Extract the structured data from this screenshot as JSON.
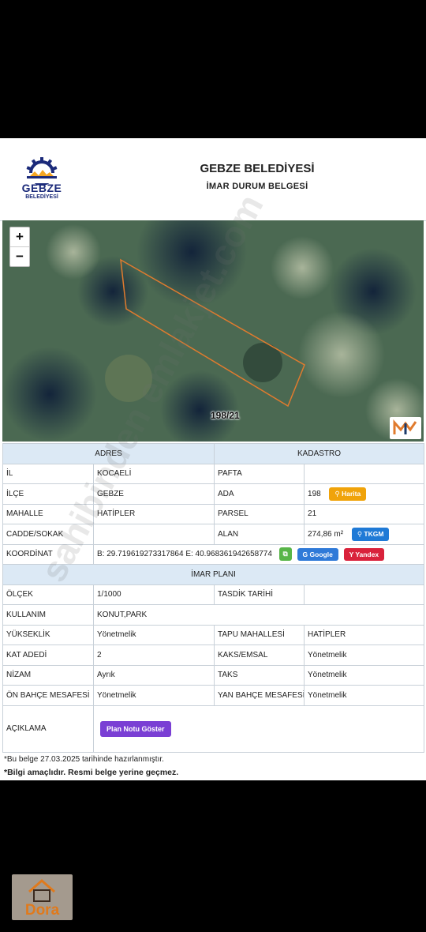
{
  "header": {
    "logo_text": "GEBZE",
    "logo_subtext": "BELEDİYESİ",
    "title": "GEBZE BELEDİYESİ",
    "subtitle": "İMAR DURUM BELGESİ"
  },
  "map": {
    "zoom_in": "+",
    "zoom_out": "−",
    "parcel_label": "198/21",
    "boundary_color": "#e07b2e"
  },
  "sections": {
    "adres": "ADRES",
    "kadastro": "KADASTRO",
    "imar": "İMAR PLANI"
  },
  "rows": {
    "il": {
      "label": "İL",
      "value": "KOCAELİ"
    },
    "pafta": {
      "label": "PAFTA",
      "value": ""
    },
    "ilce": {
      "label": "İLÇE",
      "value": "GEBZE"
    },
    "ada": {
      "label": "ADA",
      "value": "198"
    },
    "mahalle": {
      "label": "MAHALLE",
      "value": "HATİPLER"
    },
    "parsel": {
      "label": "PARSEL",
      "value": "21"
    },
    "cadde": {
      "label": "CADDE/SOKAK",
      "value": ""
    },
    "alan": {
      "label": "ALAN",
      "value": "274,86 m²"
    },
    "koordinat": {
      "label": "KOORDİNAT",
      "value": "B: 29.719619273317864 E: 40.968361942658774"
    },
    "olcek": {
      "label": "ÖLÇEK",
      "value": "1/1000"
    },
    "tasdik": {
      "label": "TASDİK TARİHİ",
      "value": ""
    },
    "kullanim": {
      "label": "KULLANIM",
      "value": "KONUT,PARK"
    },
    "yukseklik": {
      "label": "YÜKSEKLİK",
      "value": "Yönetmelik"
    },
    "tapu": {
      "label": "TAPU MAHALLESİ",
      "value": "HATİPLER"
    },
    "kat": {
      "label": "KAT ADEDİ",
      "value": "2"
    },
    "kaks": {
      "label": "KAKS/EMSAL",
      "value": "Yönetmelik"
    },
    "nizam": {
      "label": "NİZAM",
      "value": "Ayrık"
    },
    "taks": {
      "label": "TAKS",
      "value": "Yönetmelik"
    },
    "on_bahce": {
      "label": "ÖN BAHÇE MESAFESİ",
      "value": "Yönetmelik"
    },
    "yan_bahce": {
      "label": "YAN BAHÇE MESAFESİ",
      "value": "Yönetmelik"
    },
    "aciklama": {
      "label": "AÇIKLAMA"
    }
  },
  "buttons": {
    "harita": "Harita",
    "tkgm": "TKGM",
    "copy": "⧉",
    "google": "Google",
    "yandex": "Yandex",
    "plan_notu": "Plan Notu Göster"
  },
  "footer": {
    "date_note": "*Bu belge 27.03.2025 tarihinde hazırlanmıştır.",
    "disclaimer": "*Bilgi amaçlıdır. Resmi belge yerine geçmez."
  },
  "watermark": "sahibinden emlakjet.com",
  "dora": "Dora",
  "colors": {
    "section_bg": "#dce9f5",
    "harita": "#f0a30a",
    "tkgm": "#1f7ad6",
    "google": "#2f7ad8",
    "yandex": "#d9223b",
    "plan": "#7a3fd4"
  }
}
